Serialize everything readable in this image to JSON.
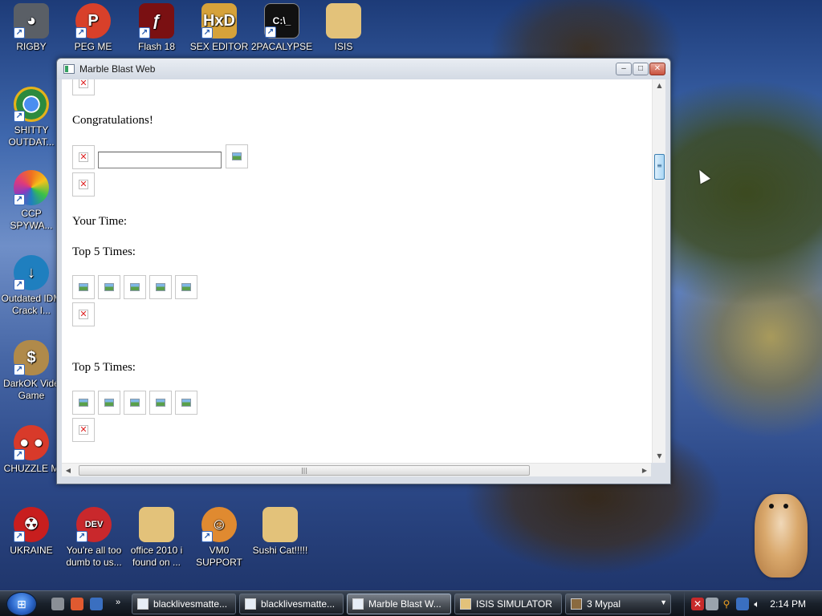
{
  "desktop": {
    "icons": [
      {
        "label": "RIGBY",
        "icon": "raccoon-icon",
        "color": "#5a5f66"
      },
      {
        "label": "PEG ME",
        "icon": "peg-icon",
        "color": "#d8402a"
      },
      {
        "label": "Flash 18",
        "icon": "flash-icon",
        "color": "#7a1012"
      },
      {
        "label": "SEX EDITOR",
        "icon": "hex-editor-icon",
        "color": "#d6a23a"
      },
      {
        "label": "2PACALYPSE",
        "icon": "terminal-icon",
        "color": "#111111"
      },
      {
        "label": "ISIS",
        "icon": "folder-icon",
        "color": "#e3c27a"
      },
      {
        "label": "SHITTY OUTDAT...",
        "icon": "chrome-icon",
        "color": "#2c8a3e"
      },
      {
        "label": "CCP SPYWA...",
        "icon": "pinwheel-icon",
        "color": "#f07020"
      },
      {
        "label": "Outdated IDM Crack I...",
        "icon": "globe-download-icon",
        "color": "#1f7fbf"
      },
      {
        "label": "DarkOK Vide Game",
        "icon": "money-bag-icon",
        "color": "#b08a4a"
      },
      {
        "label": "CHUZZLE M",
        "icon": "chuzzle-icon",
        "color": "#d83a2a"
      },
      {
        "label": "UKRAINE",
        "icon": "radiation-icon",
        "color": "#c81e1e"
      },
      {
        "label": "You're all too dumb to us...",
        "icon": "devcpp-icon",
        "color": "#c9282c"
      },
      {
        "label": "office 2010 i found on ...",
        "icon": "folder-icon",
        "color": "#e3c27a"
      },
      {
        "label": "VM0 SUPPORT",
        "icon": "support-person-icon",
        "color": "#e08a30"
      },
      {
        "label": "Sushi Cat!!!!!",
        "icon": "folder-icon",
        "color": "#e3c27a"
      }
    ]
  },
  "window": {
    "title": "Marble Blast Web",
    "minimize": "–",
    "maximize": "□",
    "close": "✕"
  },
  "page": {
    "congrats": "Congratulations!",
    "your_time": "Your Time:",
    "top5_a": "Top 5 Times:",
    "top5_b": "Top 5 Times:",
    "name_field_value": ""
  },
  "scrollbars": {
    "up": "▲",
    "down": "▼",
    "left": "◀",
    "right": "▶",
    "grip": "≡",
    "hgrip": "|||"
  },
  "taskbar": {
    "start": "⊞",
    "chevron": "»",
    "buttons": [
      {
        "label": "blacklivesmatte...",
        "active": false
      },
      {
        "label": "blacklivesmatte...",
        "active": false
      },
      {
        "label": "Marble Blast W...",
        "active": true
      },
      {
        "label": "ISIS SIMULATOR",
        "active": false
      },
      {
        "label": "3 Mypal",
        "active": false
      }
    ],
    "clock": "2:14 PM"
  }
}
